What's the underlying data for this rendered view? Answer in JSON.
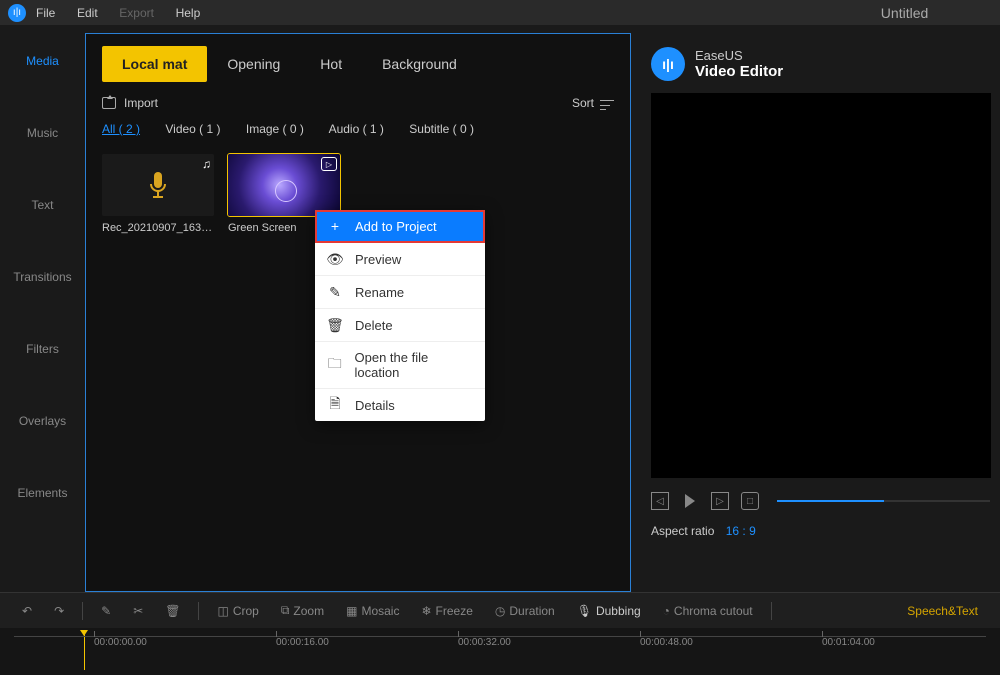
{
  "title": "Untitled",
  "menu": {
    "file": "File",
    "edit": "Edit",
    "export": "Export",
    "help": "Help"
  },
  "sidebar": [
    "Media",
    "Music",
    "Text",
    "Transitions",
    "Filters",
    "Overlays",
    "Elements"
  ],
  "tabs": [
    "Local mat",
    "Opening",
    "Hot",
    "Background"
  ],
  "panel": {
    "import": "Import",
    "sort": "Sort"
  },
  "filters": [
    {
      "label": "All ( 2 )",
      "active": true
    },
    {
      "label": "Video ( 1 )"
    },
    {
      "label": "Image ( 0 )"
    },
    {
      "label": "Audio ( 1 )"
    },
    {
      "label": "Subtitle ( 0 )"
    }
  ],
  "items": [
    {
      "caption": "Rec_20210907_1635..."
    },
    {
      "caption": "Green Screen"
    }
  ],
  "context": {
    "add": "Add to Project",
    "preview": "Preview",
    "rename": "Rename",
    "delete": "Delete",
    "openloc": "Open the file location",
    "details": "Details"
  },
  "brand": {
    "line1": "EaseUS",
    "line2": "Video Editor"
  },
  "aspect": {
    "label": "Aspect ratio",
    "value": "16 : 9"
  },
  "tools": {
    "crop": "Crop",
    "zoom": "Zoom",
    "mosaic": "Mosaic",
    "freeze": "Freeze",
    "duration": "Duration",
    "dubbing": "Dubbing",
    "chroma": "Chroma cutout",
    "speech": "Speech&Text"
  },
  "timeline": {
    "t0": "00:00:00.00",
    "t1": "00:00:16.00",
    "t2": "00:00:32.00",
    "t3": "00:00:48.00",
    "t4": "00:01:04.00"
  }
}
